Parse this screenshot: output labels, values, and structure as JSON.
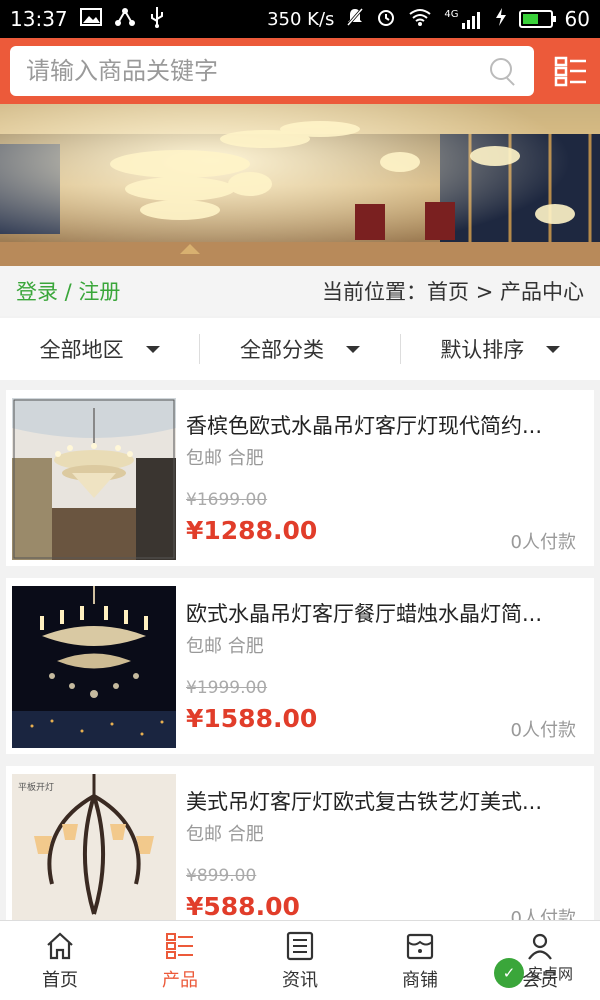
{
  "status_bar": {
    "time": "13:37",
    "speed": "350 K/s",
    "network": "4G",
    "battery": "60",
    "battery_level": 0.6
  },
  "search": {
    "placeholder": "请输入商品关键字"
  },
  "nav": {
    "login": "登录 / 注册",
    "location_label": "当前位置：",
    "location_path": "首页 > 产品中心"
  },
  "filters": [
    {
      "label": "全部地区"
    },
    {
      "label": "全部分类"
    },
    {
      "label": "默认排序"
    }
  ],
  "products": [
    {
      "title": "香槟色欧式水晶吊灯客厅灯现代简约...",
      "meta": "包邮 合肥",
      "old_price": "¥1699.00",
      "price": "¥1288.00",
      "paid": "0人付款"
    },
    {
      "title": "欧式水晶吊灯客厅餐厅蜡烛水晶灯简...",
      "meta": "包邮 合肥",
      "old_price": "¥1999.00",
      "price": "¥1588.00",
      "paid": "0人付款"
    },
    {
      "title": "美式吊灯客厅灯欧式复古铁艺灯美式...",
      "meta": "包邮 合肥",
      "old_price": "¥899.00",
      "price": "¥588.00",
      "paid": "0人付款"
    }
  ],
  "product3_tag": "平板开灯",
  "tabbar": [
    {
      "label": "首页",
      "icon": "home-icon"
    },
    {
      "label": "产品",
      "icon": "list-icon"
    },
    {
      "label": "资讯",
      "icon": "news-icon"
    },
    {
      "label": "商铺",
      "icon": "store-icon"
    },
    {
      "label": "会员",
      "icon": "user-icon"
    }
  ],
  "watermark": {
    "text": "安卓网"
  },
  "colors": {
    "header": "#ec5a3a",
    "price": "#e13d2a",
    "login": "#3aa63a",
    "active_tab": "#ec5a3a"
  }
}
